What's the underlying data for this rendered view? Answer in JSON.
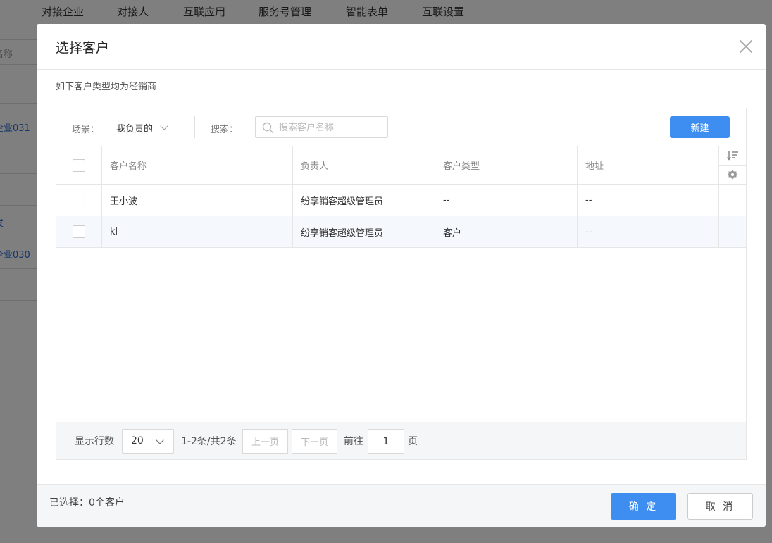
{
  "background": {
    "nav_tabs": [
      "对接企业",
      "对接人",
      "互联应用",
      "服务号管理",
      "智能表单",
      "互联设置"
    ],
    "list_fragments": [
      "名称",
      "企业031",
      "发",
      "企业030"
    ]
  },
  "modal": {
    "title": "选择客户",
    "hint": "如下客户类型均为经销商",
    "toolbar": {
      "scene_label": "场景：",
      "scene_value": "我负责的",
      "search_label": "搜索：",
      "search_placeholder": "搜索客户名称",
      "new_button": "新建"
    },
    "table": {
      "headers": [
        "客户名称",
        "负责人",
        "客户类型",
        "地址"
      ],
      "rows": [
        {
          "name": "王小波",
          "owner": "纷享销客超级管理员",
          "type": "--",
          "address": "--"
        },
        {
          "name": "kl",
          "owner": "纷享销客超级管理员",
          "type": "客户",
          "address": "--"
        }
      ]
    },
    "pagination": {
      "rows_label": "显示行数",
      "page_size": "20",
      "range_text": "1-2条/共2条",
      "prev": "上一页",
      "next": "下一页",
      "goto_label": "前往",
      "current_page": "1",
      "page_suffix": "页"
    },
    "footer": {
      "selected_text": "已选择：0个客户",
      "confirm": "确 定",
      "cancel": "取 消"
    }
  },
  "colors": {
    "accent": "#3d8ef0",
    "overlay": "rgba(0,0,0,0.5)",
    "link": "#2d6bd1"
  }
}
